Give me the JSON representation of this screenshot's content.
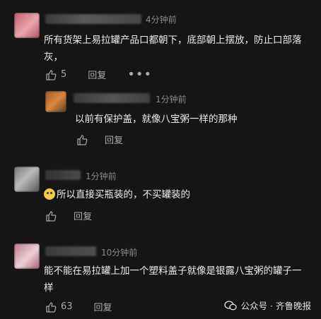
{
  "comments": [
    {
      "time": "4分钟前",
      "text": "所有货架上易拉罐产品口都朝下，底部朝上摆放，防止口部落灰，",
      "likes": "5",
      "reply_label": "回复",
      "more_label": "•••",
      "avatar_colors": [
        "#c65c6d",
        "#e7a7b0"
      ]
    },
    {
      "time": "1分钟前",
      "text": "以前有保护盖，就像八宝粥一样的那种",
      "reply_label": "回复",
      "avatar_colors": [
        "#9a5a2a",
        "#d98a3f"
      ]
    },
    {
      "time": "1分钟前",
      "text": "所以直接买瓶装的，不买罐装的",
      "reply_label": "回复",
      "avatar_colors": [
        "#777777",
        "#bbbbbb"
      ]
    },
    {
      "time": "10分钟前",
      "text": "能不能在易拉罐上加一个塑料盖子就像是银露八宝粥的罐子一样",
      "likes": "63",
      "reply_label": "回复",
      "avatar_colors": [
        "#bd7886",
        "#ead1d7"
      ]
    }
  ],
  "watermark": {
    "label": "公众号 · 齐鲁晚报"
  }
}
